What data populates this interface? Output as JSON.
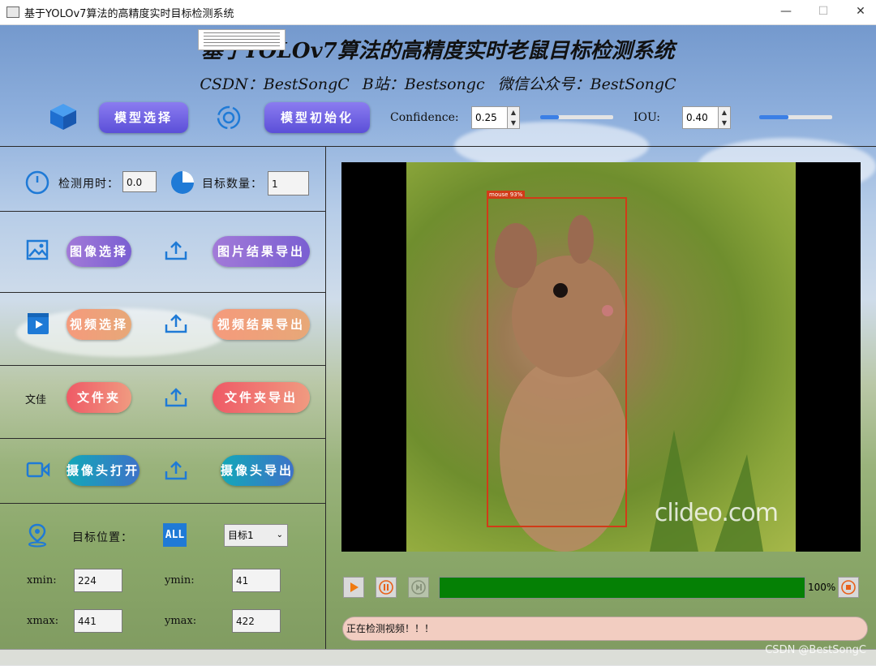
{
  "window": {
    "title": "基于YOLOv7算法的高精度实时目标检测系统",
    "min": "—",
    "max": "☐",
    "close": "✕"
  },
  "header": {
    "title": "基于YOLOv7算法的高精度实时老鼠目标检测系统",
    "subtitle": "CSDN：BestSongC   B站：Bestsongc   微信公众号：BestSongC"
  },
  "toolbar": {
    "model_select": "模型选择",
    "model_init": "模型初始化",
    "confidence_label": "Confidence:",
    "confidence_value": "0.25",
    "confidence_fraction": 0.25,
    "iou_label": "IOU:",
    "iou_value": "0.40",
    "iou_fraction": 0.4
  },
  "stats": {
    "time_label": "检测用时：",
    "time_value": "0.0",
    "count_label": "目标数量：",
    "count_value": "1"
  },
  "image": {
    "select": "图像选择",
    "export": "图片结果导出"
  },
  "video": {
    "select": "视频选择",
    "export": "视频结果导出"
  },
  "folder": {
    "icon_text": "文佳",
    "select": "文件夹",
    "export": "文件夹导出"
  },
  "camera": {
    "open": "摄像头打开",
    "export": "摄像头导出"
  },
  "position": {
    "label": "目标位置：",
    "all_text": "ALL",
    "target_selected": "目标1",
    "xmin_label": "xmin:",
    "xmin": "224",
    "ymin_label": "ymin:",
    "ymin": "41",
    "xmax_label": "xmax:",
    "xmax": "441",
    "ymax_label": "ymax:",
    "ymax": "422"
  },
  "detection": {
    "label": "mouse 93%",
    "watermark": "clideo.com"
  },
  "player": {
    "progress_percent": "100%",
    "progress_fraction": 1.0
  },
  "status_text": "正在检测视频！！！",
  "footer_watermark": "CSDN @BestSongC",
  "colors": {
    "accent_blue": "#1f7ad6",
    "progress_green": "#058005",
    "bbox_red": "#d13b18"
  }
}
